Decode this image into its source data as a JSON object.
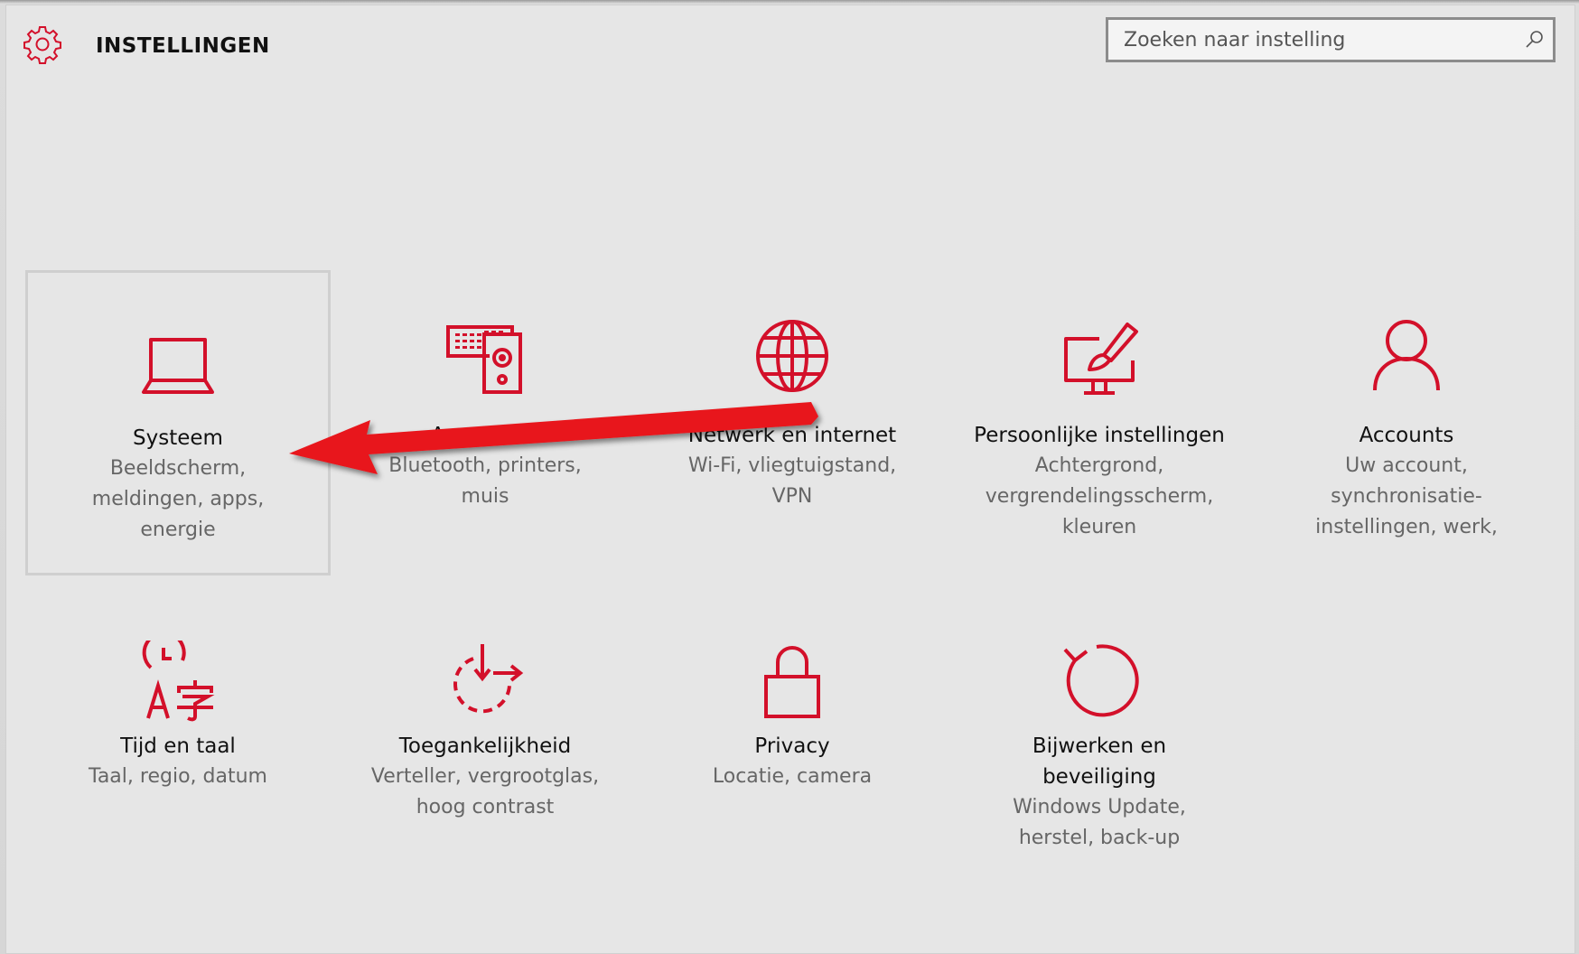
{
  "app": {
    "title": "INSTELLINGEN"
  },
  "search": {
    "placeholder": "Zoeken naar instelling"
  },
  "accent_color": "#d3102a",
  "annotation_color": "#e8141a",
  "tiles": [
    {
      "title": "Systeem",
      "desc": "Beeldscherm,\nmeldingen, apps,\nenergie",
      "icon": "laptop-icon"
    },
    {
      "title": "Apparaten",
      "desc": "Bluetooth, printers,\nmuis",
      "icon": "devices-icon"
    },
    {
      "title": "Netwerk en internet",
      "desc": "Wi-Fi, vliegtuigstand,\nVPN",
      "icon": "globe-icon"
    },
    {
      "title": "Persoonlijke instellingen",
      "desc": "Achtergrond,\nvergrendelingsscherm,\nkleuren",
      "icon": "personalization-icon"
    },
    {
      "title": "Accounts",
      "desc": "Uw account,\nsynchronisatie-\ninstellingen, werk,",
      "icon": "person-icon"
    },
    {
      "title": "Tijd en taal",
      "desc": "Taal, regio, datum",
      "icon": "time-language-icon"
    },
    {
      "title": "Toegankelijkheid",
      "desc": "Verteller, vergrootglas,\nhoog contrast",
      "icon": "accessibility-icon"
    },
    {
      "title": "Privacy",
      "desc": "Locatie, camera",
      "icon": "lock-icon"
    },
    {
      "title": "Bijwerken en\nbeveiliging",
      "desc": "Windows Update,\nherstel, back-up",
      "icon": "update-icon"
    }
  ]
}
